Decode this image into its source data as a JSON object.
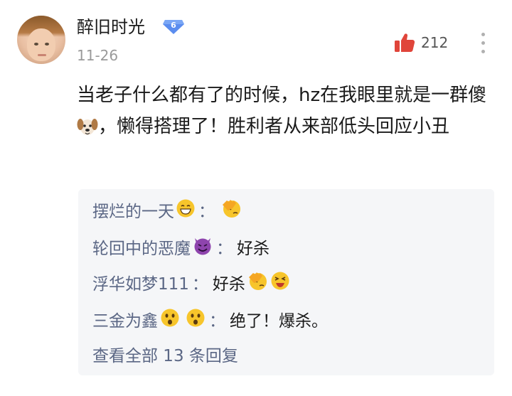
{
  "comment": {
    "username": "醉旧时光",
    "level": "6",
    "timestamp": "11-26",
    "like_count": "212",
    "text_part1": "当老子什么都有了的时候，hz在我眼里就是一群傻",
    "text_part2": "，懒得搭理了！胜利者从来部低头回应小丑"
  },
  "replies": [
    {
      "author": "摆烂的一天",
      "colon": "：",
      "text": ""
    },
    {
      "author": "轮回中的恶魔",
      "colon": "：",
      "text": "好杀"
    },
    {
      "author": "浮华如梦111",
      "colon": "：",
      "text": "好杀"
    },
    {
      "author": "三金为鑫",
      "colon": "：",
      "text": "绝了！爆杀。"
    }
  ],
  "view_all": "查看全部 13 条回复",
  "colors": {
    "author_link": "#5b6785",
    "like_icon": "#e0453a",
    "level_badge": "#5b8def",
    "reply_bg": "#f5f6f8"
  },
  "icons": [
    "avatar",
    "level-badge-icon",
    "thumbs-up-icon",
    "more-icon",
    "dog-emoji-icon",
    "grin-emoji-icon",
    "facepalm-emoji-icon",
    "devil-emoji-icon",
    "laughing-emoji-icon",
    "hushed-emoji-icon"
  ]
}
